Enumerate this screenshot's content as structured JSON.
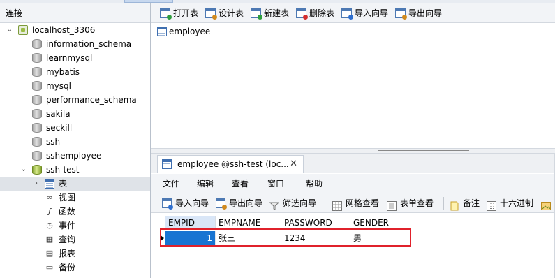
{
  "left_panel": {
    "header": "连接",
    "tree": [
      {
        "label": "localhost_3306",
        "icon": "connection-icon",
        "expanded": true
      },
      {
        "label": "information_schema",
        "icon": "database-icon"
      },
      {
        "label": "learnmysql",
        "icon": "database-icon"
      },
      {
        "label": "mybatis",
        "icon": "database-icon"
      },
      {
        "label": "mysql",
        "icon": "database-icon"
      },
      {
        "label": "performance_schema",
        "icon": "database-icon"
      },
      {
        "label": "sakila",
        "icon": "database-icon"
      },
      {
        "label": "seckill",
        "icon": "database-icon"
      },
      {
        "label": "ssh",
        "icon": "database-icon"
      },
      {
        "label": "sshemployee",
        "icon": "database-icon"
      },
      {
        "label": "ssh-test",
        "icon": "database-icon",
        "expanded": true
      },
      {
        "label": "表",
        "icon": "table-icon",
        "selected": true
      },
      {
        "label": "视图",
        "icon": "view-icon"
      },
      {
        "label": "函数",
        "icon": "function-icon"
      },
      {
        "label": "事件",
        "icon": "event-icon"
      },
      {
        "label": "查询",
        "icon": "query-icon"
      },
      {
        "label": "报表",
        "icon": "report-icon"
      },
      {
        "label": "备份",
        "icon": "backup-icon"
      }
    ]
  },
  "toolbar": {
    "buttons": [
      {
        "label": "打开表",
        "icon": "open-table-icon",
        "color": "#2e9e3e"
      },
      {
        "label": "设计表",
        "icon": "design-table-icon",
        "color": "#d08a1e"
      },
      {
        "label": "新建表",
        "icon": "new-table-icon",
        "color": "#2e9e3e"
      },
      {
        "label": "删除表",
        "icon": "delete-table-icon",
        "color": "#d32f2f"
      },
      {
        "label": "导入向导",
        "icon": "import-wizard-icon",
        "color": "#2e6fd0"
      },
      {
        "label": "导出向导",
        "icon": "export-wizard-icon",
        "color": "#d08a1e"
      }
    ]
  },
  "objects": {
    "items": [
      {
        "label": "employee",
        "icon": "table-icon"
      }
    ]
  },
  "document": {
    "tab_title": "employee @ssh-test (loc...",
    "tab_close": "✕",
    "menu": [
      "文件",
      "编辑",
      "查看",
      "窗口",
      "帮助"
    ],
    "toolbar": [
      {
        "label": "导入向导",
        "icon": "import-wizard-icon"
      },
      {
        "label": "导出向导",
        "icon": "export-wizard-icon"
      },
      {
        "label": "筛选向导",
        "icon": "filter-icon"
      },
      {
        "label": "网格查看",
        "icon": "grid-view-icon"
      },
      {
        "label": "表单查看",
        "icon": "form-view-icon"
      },
      {
        "label": "备注",
        "icon": "memo-icon"
      },
      {
        "label": "十六进制",
        "icon": "hex-icon"
      }
    ]
  },
  "grid": {
    "columns": [
      "EMPID",
      "EMPNAME",
      "PASSWORD",
      "GENDER"
    ],
    "rows": [
      [
        "1",
        "张三",
        "1234",
        "男"
      ]
    ]
  },
  "colors": {
    "selection": "#1874d2",
    "highlight_box": "#e0212b",
    "sorted_header": "#d9e6f7"
  }
}
